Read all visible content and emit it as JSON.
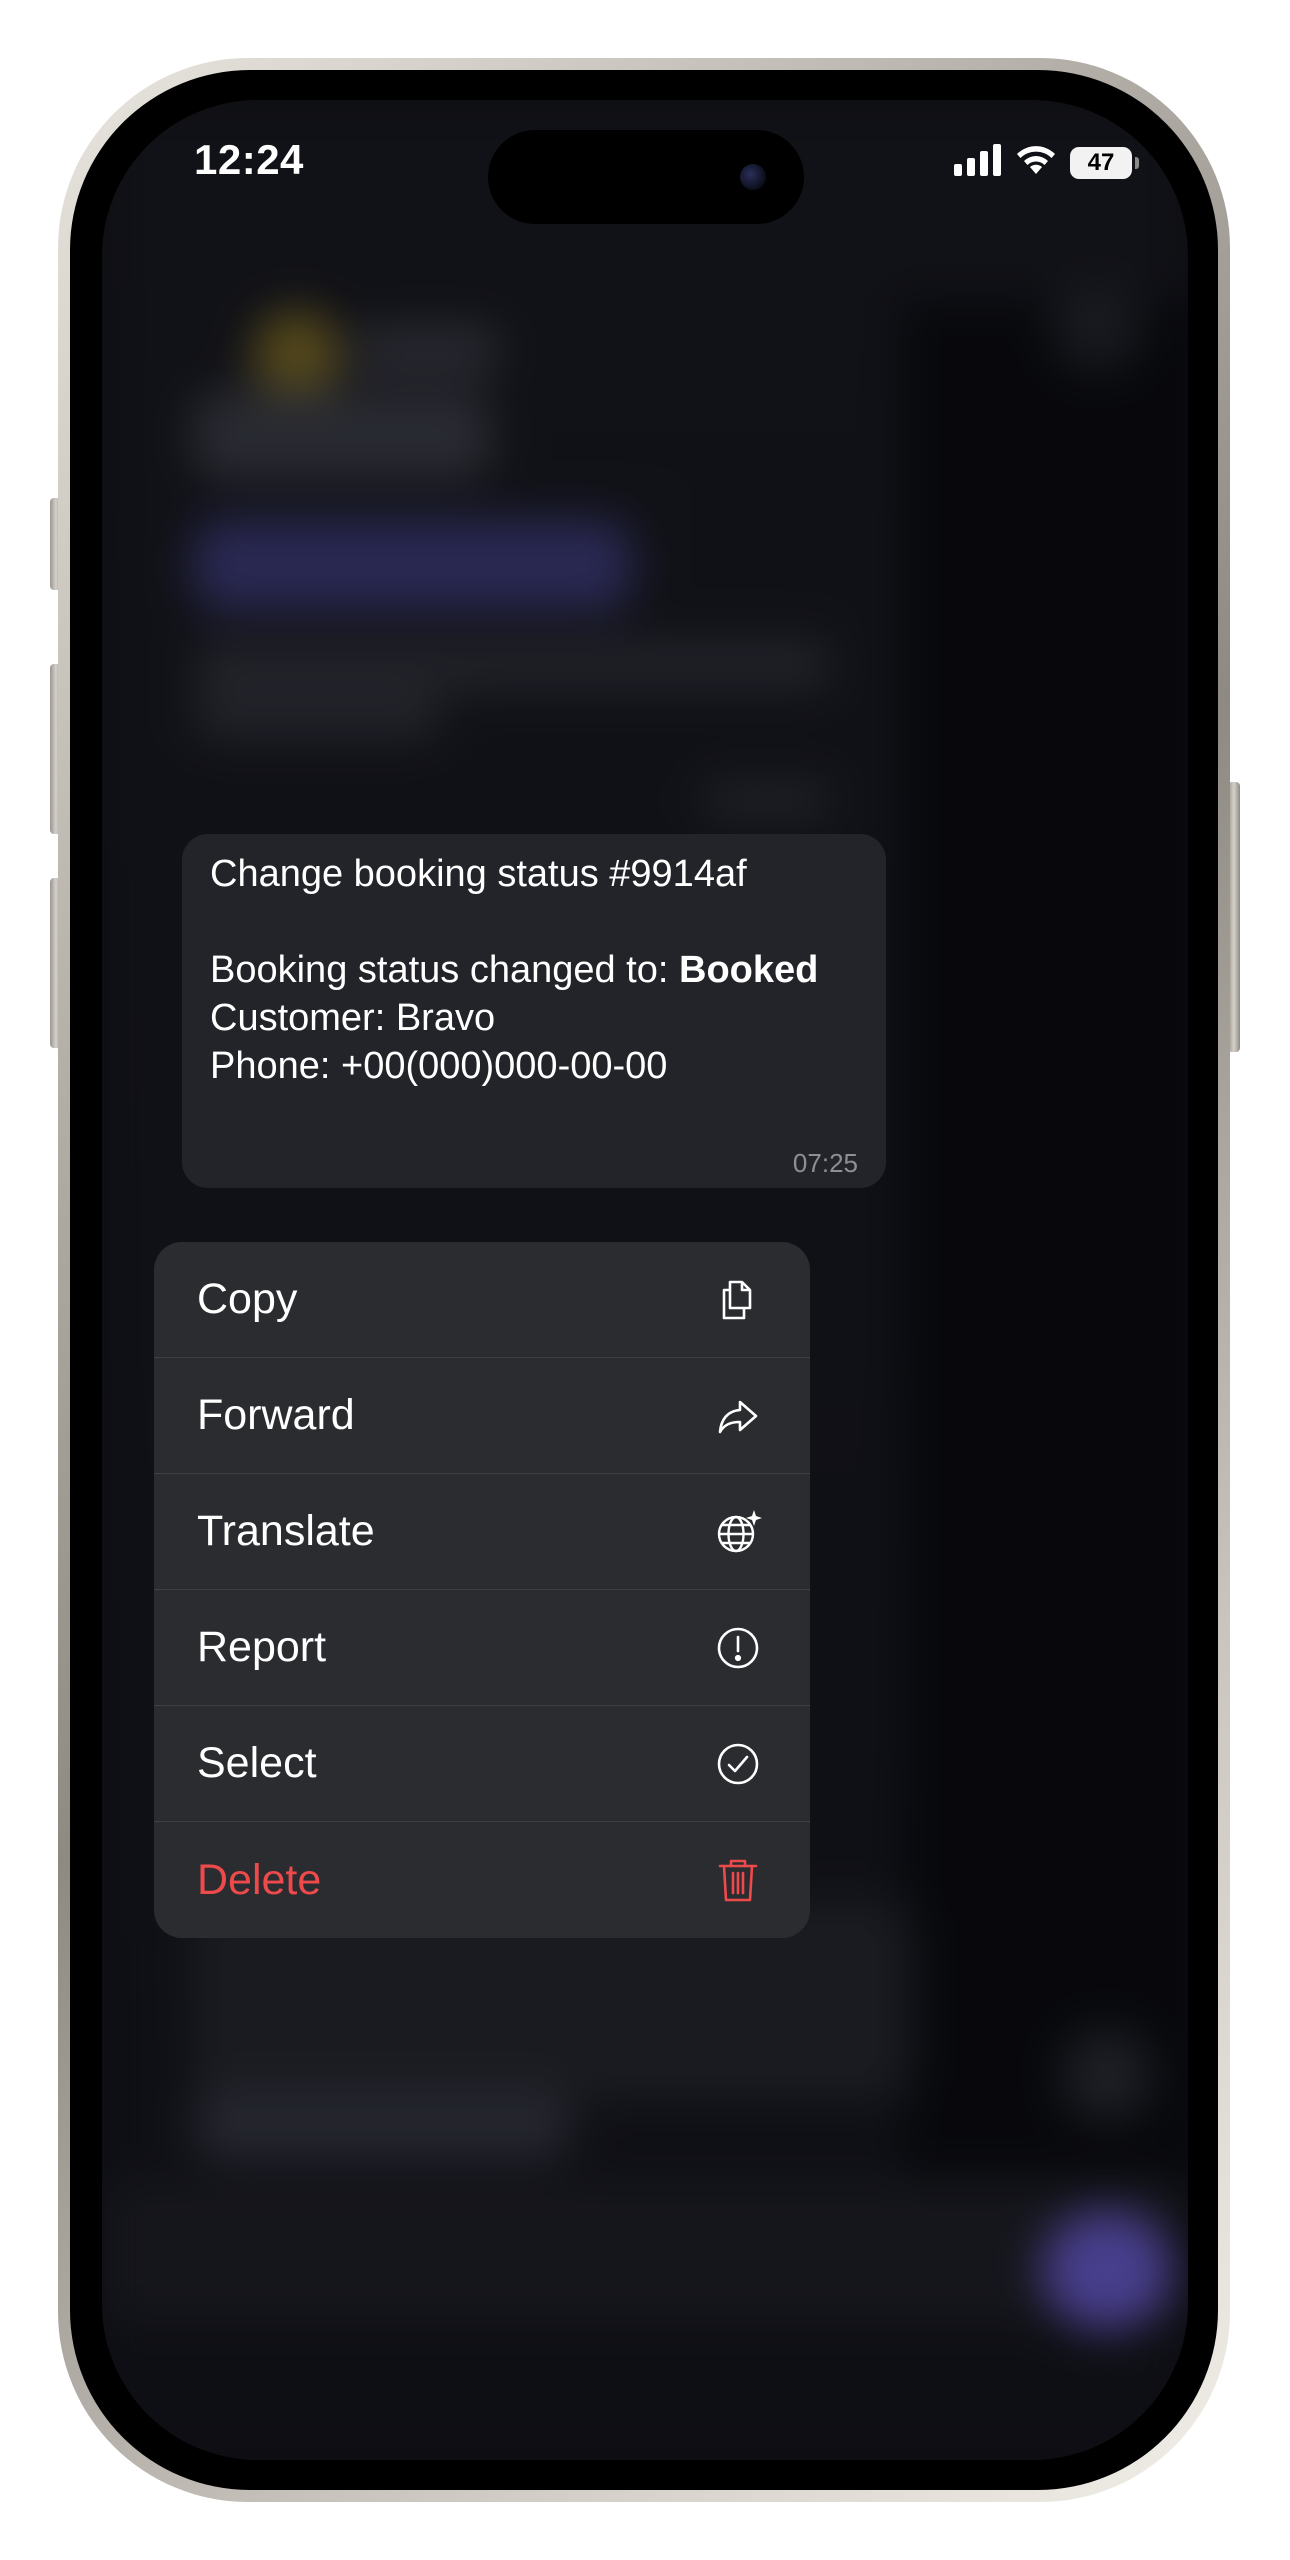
{
  "status_bar": {
    "time": "12:24",
    "battery": "47",
    "icons": [
      "cellular-signal-icon",
      "wifi-icon",
      "battery-icon"
    ]
  },
  "message": {
    "title": "Change booking status #9914af",
    "status_prefix": "Booking status changed to: ",
    "status_value": "Booked",
    "customer": "Customer: Bravo",
    "phone": "Phone: +00(000)000-00-00",
    "time": "07:25"
  },
  "context_menu": {
    "items": [
      {
        "label": "Copy",
        "icon": "copy-icon"
      },
      {
        "label": "Forward",
        "icon": "forward-icon"
      },
      {
        "label": "Translate",
        "icon": "translate-globe-icon"
      },
      {
        "label": "Report",
        "icon": "report-icon"
      },
      {
        "label": "Select",
        "icon": "select-check-icon"
      },
      {
        "label": "Delete",
        "icon": "trash-icon"
      }
    ]
  },
  "colors": {
    "bubble": "#232429",
    "menu": "#2b2c30",
    "delete": "#ee4a4b",
    "accent": "#7b6be0"
  }
}
